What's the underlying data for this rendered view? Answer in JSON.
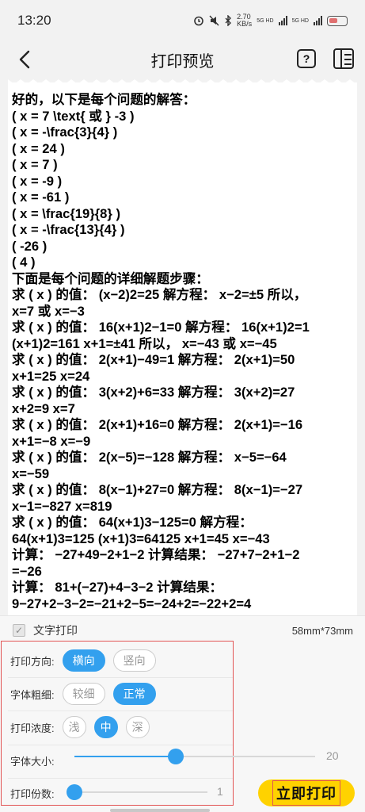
{
  "status_bar": {
    "time": "13:20",
    "net_speed": "2.70",
    "net_unit": "KB/s",
    "sig1": "5G HD",
    "sig2": "5G HD"
  },
  "nav": {
    "title": "打印预览",
    "help_glyph": "?",
    "back_icon": "chevron-left-icon",
    "list_icon": "list-panel-icon"
  },
  "paper": {
    "lines": [
      "好的，以下是每个问题的解答：",
      "( x = 7 \\text{ 或 } -3 )",
      "( x = -\\frac{3}{4} )",
      "( x = 24 )",
      "( x = 7 )",
      "( x = -9 )",
      "( x = -61 )",
      "( x = \\frac{19}{8} )",
      "( x = -\\frac{13}{4} )",
      "( -26 )",
      "( 4 )",
      "下面是每个问题的详细解题步骤：",
      "求 ( x ) 的值： (x−2)2=25 解方程： x−2=±5 所以，",
      "x=7 或 x=−3",
      "求 ( x ) 的值： 16(x+1)2−1=0 解方程： 16(x+1)2=1",
      "(x+1)2=161 x+1=±41 所以， x=−43 或 x=−45",
      "求 ( x ) 的值： 2(x+1)−49=1 解方程： 2(x+1)=50",
      "x+1=25 x=24",
      "求 ( x ) 的值： 3(x+2)+6=33 解方程： 3(x+2)=27",
      "x+2=9 x=7",
      "求 ( x ) 的值： 2(x+1)+16=0 解方程： 2(x+1)=−16",
      "x+1=−8 x=−9",
      "求 ( x ) 的值： 2(x−5)=−128 解方程： x−5=−64",
      "x=−59",
      "求 ( x ) 的值： 8(x−1)+27=0 解方程： 8(x−1)=−27",
      "x−1=−827 x=819",
      "求 ( x ) 的值： 64(x+1)3−125=0 解方程：",
      "64(x+1)3=125 (x+1)3=64125 x+1=45 x=−43",
      "计算： −27+49−2+1−2 计算结果： −27+7−2+1−2",
      "=−26",
      "计算： 81+(−27)+4−3−2 计算结果：",
      "9−27+2−3−2=−21+2−5=−24+2=−22+2=4"
    ]
  },
  "panel": {
    "text_print_label": "文字打印",
    "text_print_checked": true,
    "paper_size": "58mm*73mm",
    "direction": {
      "label": "打印方向:",
      "options": [
        "横向",
        "竖向"
      ],
      "selected": "横向"
    },
    "weight": {
      "label": "字体粗细:",
      "options": [
        "较细",
        "正常"
      ],
      "selected": "正常"
    },
    "density": {
      "label": "打印浓度:",
      "options": [
        "浅",
        "中",
        "深"
      ],
      "selected": "中"
    },
    "font_size": {
      "label": "字体大小:",
      "value": "20",
      "fraction": 0.42
    },
    "copies": {
      "label": "打印份数:",
      "value": "1",
      "fraction": 0.0
    },
    "print_button": "立即打印"
  },
  "colors": {
    "accent": "#33a0ee",
    "print_button": "#ffd200",
    "highlight_border": "#e25555"
  }
}
